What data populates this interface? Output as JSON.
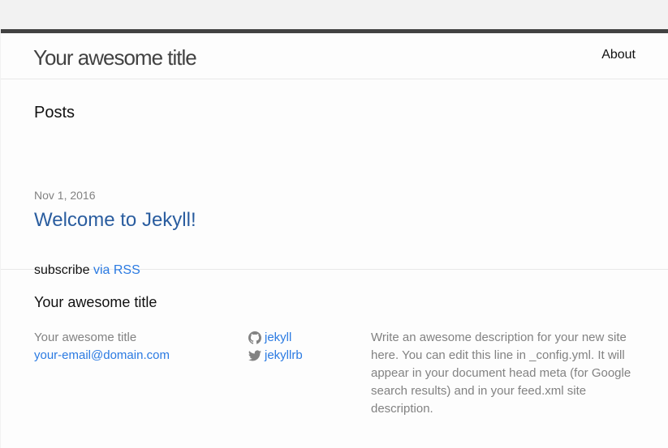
{
  "header": {
    "site_title": "Your awesome title",
    "nav": [
      "About"
    ]
  },
  "main": {
    "posts_heading": "Posts",
    "posts": [
      {
        "date": "Nov 1, 2016",
        "title": "Welcome to Jekyll!"
      }
    ],
    "subscribe_text": "subscribe",
    "subscribe_link": "via RSS"
  },
  "footer": {
    "heading": "Your awesome title",
    "site_name": "Your awesome title",
    "email": "your-email@domain.com",
    "github_username": "jekyll",
    "twitter_username": "jekyllrb",
    "description": "Write an awesome description for your new site here. You can edit this line in _config.yml. It will appear in your document head meta (for Google search results) and in your feed.xml site description."
  },
  "colors": {
    "link": "#2a7ae2",
    "post_link": "#2a5d9f",
    "header_border": "#424242",
    "muted": "#828282"
  },
  "icons": [
    "github-icon",
    "twitter-icon"
  ]
}
